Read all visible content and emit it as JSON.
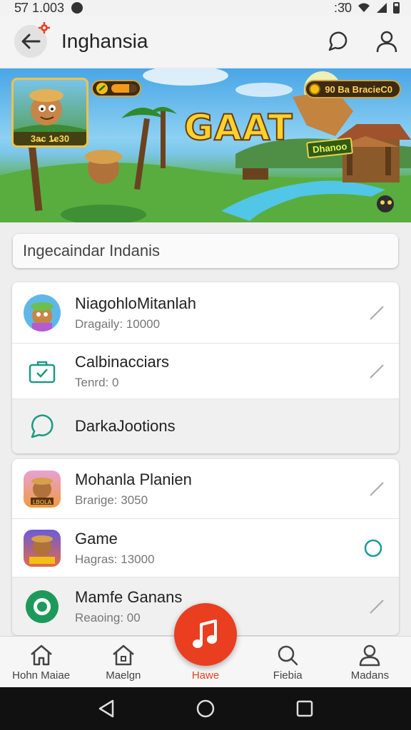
{
  "status_bar": {
    "time": "5̄7 1.003",
    "right_text": ":3̄0"
  },
  "app_bar": {
    "title": "Inghansia"
  },
  "banner": {
    "headline": "GAAT",
    "thumb_caption": "3a̶c 1̶e30",
    "points_label": "90 Ba BracieC0",
    "tag_label": "Dhanoo",
    "progress_fraction": 0.7
  },
  "search": {
    "placeholder": "Ingecaindar Indanis"
  },
  "list_group_1": [
    {
      "title": "NiagohloMitanlah",
      "subtitle": "Dragaily: 10000",
      "icon": "character-avatar-icon",
      "trailing": "edit-icon"
    },
    {
      "title": "Calbinacciars",
      "subtitle": "Tenrd: 0",
      "icon": "briefcase-check-icon",
      "trailing": "edit-icon"
    },
    {
      "title": "DarkaJootions",
      "subtitle": "",
      "icon": "chat-bubble-icon",
      "trailing": ""
    }
  ],
  "list_group_2": [
    {
      "title": "Mohanla Planien",
      "subtitle": "Brarige: 3050",
      "icon": "game-character-icon",
      "trailing": "edit-icon"
    },
    {
      "title": "Game",
      "subtitle": "Hagras: 13000",
      "icon": "game-character-icon",
      "trailing": "circle-icon"
    },
    {
      "title": "Mamfe Ganans",
      "subtitle": "Reaoing: 00",
      "icon": "record-icon",
      "trailing": "edit-icon"
    }
  ],
  "bottom_nav": [
    {
      "label": "Hohn Maiae",
      "icon": "home-icon"
    },
    {
      "label": "Maelgn",
      "icon": "house-icon"
    },
    {
      "label": "Hawe",
      "icon": "music-note-icon",
      "active": true
    },
    {
      "label": "Fiebia",
      "icon": "search-icon"
    },
    {
      "label": "Madans",
      "icon": "profile-icon"
    }
  ],
  "colors": {
    "accent": "#ea3e20",
    "teal": "#1d9a82",
    "banner_headline": "#ffd12e"
  }
}
